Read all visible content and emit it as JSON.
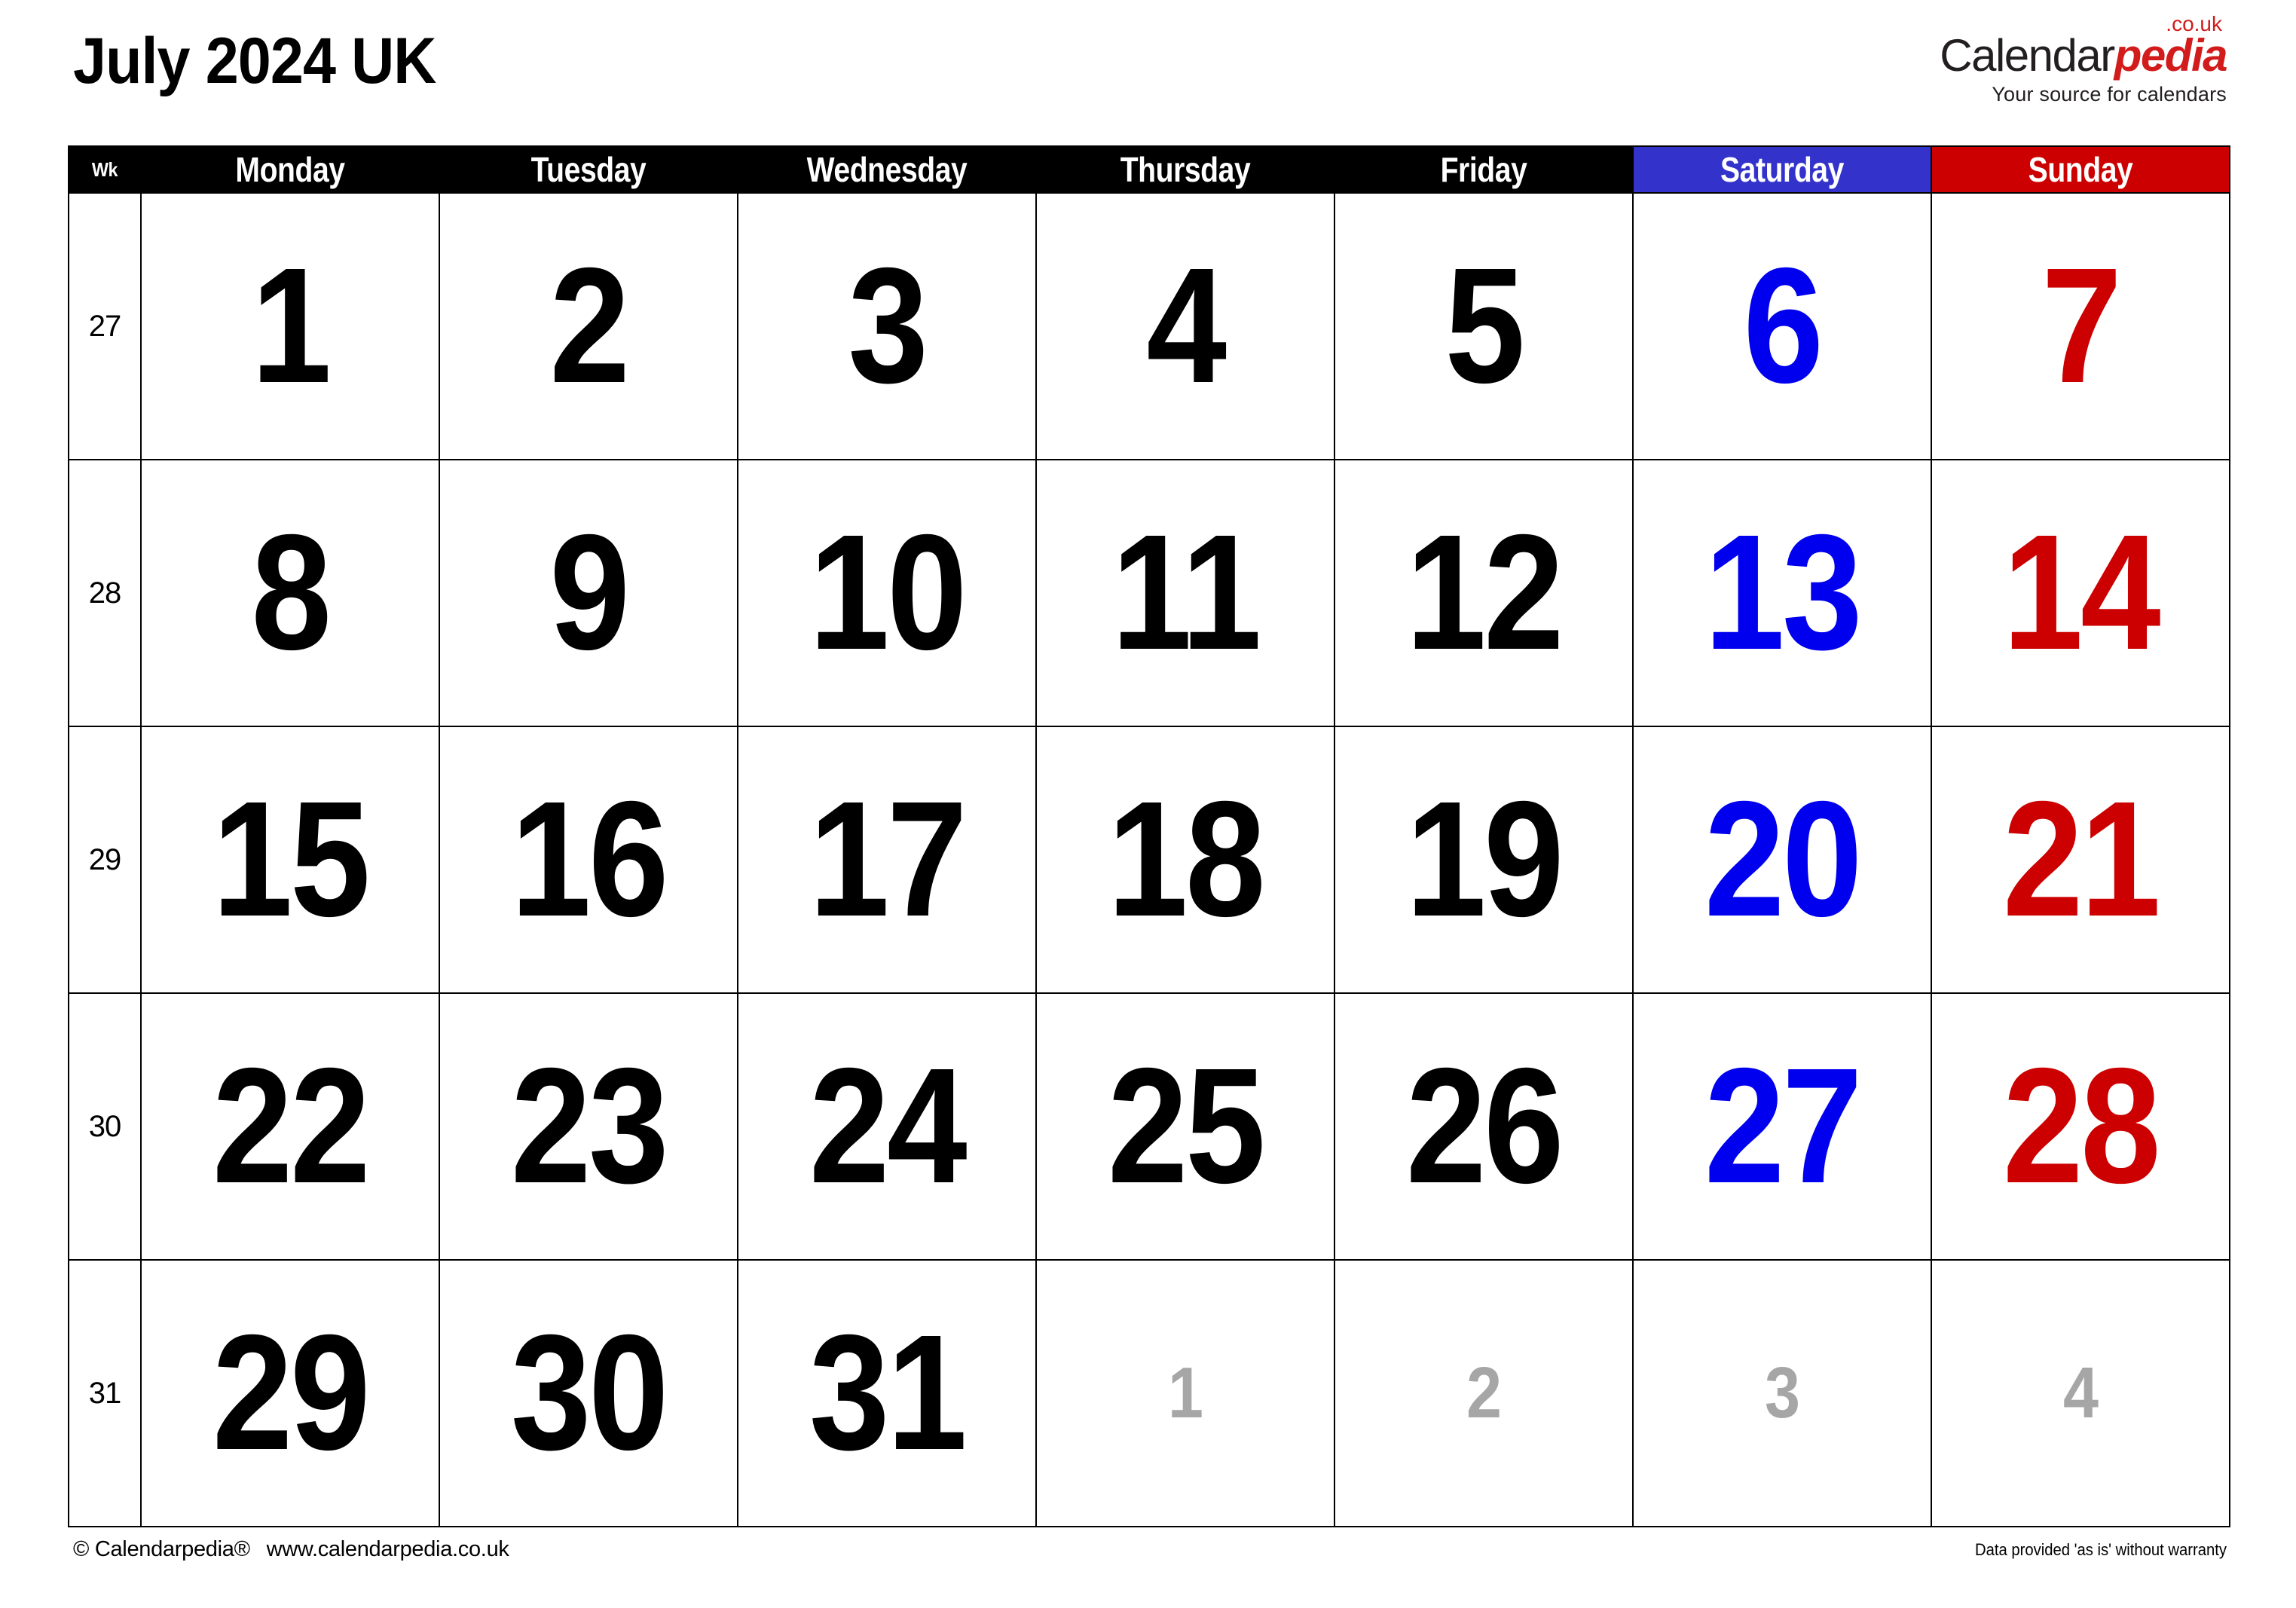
{
  "header": {
    "title": "July 2024 UK"
  },
  "logo": {
    "name_first": "Calendar",
    "name_second": "pedia",
    "tld": ".co.uk",
    "tagline": "Your source for calendars"
  },
  "calendar": {
    "week_column_header": "Wk",
    "day_headers": [
      "Monday",
      "Tuesday",
      "Wednesday",
      "Thursday",
      "Friday",
      "Saturday",
      "Sunday"
    ],
    "colors": {
      "header_background": "#000000",
      "header_text": "#ffffff",
      "saturday_background": "#3333cc",
      "sunday_background": "#cc0000",
      "saturday_text": "#0000ee",
      "sunday_text": "#cc0000",
      "weekday_text": "#000000",
      "other_month_text": "#a6a6a6",
      "grid_line": "#000000",
      "cell_background": "#ffffff"
    },
    "weeks": [
      {
        "week_number": "27",
        "days": [
          {
            "label": "1",
            "kind": "weekday"
          },
          {
            "label": "2",
            "kind": "weekday"
          },
          {
            "label": "3",
            "kind": "weekday"
          },
          {
            "label": "4",
            "kind": "weekday"
          },
          {
            "label": "5",
            "kind": "weekday"
          },
          {
            "label": "6",
            "kind": "saturday"
          },
          {
            "label": "7",
            "kind": "sunday"
          }
        ]
      },
      {
        "week_number": "28",
        "days": [
          {
            "label": "8",
            "kind": "weekday"
          },
          {
            "label": "9",
            "kind": "weekday"
          },
          {
            "label": "10",
            "kind": "weekday"
          },
          {
            "label": "11",
            "kind": "weekday"
          },
          {
            "label": "12",
            "kind": "weekday"
          },
          {
            "label": "13",
            "kind": "saturday"
          },
          {
            "label": "14",
            "kind": "sunday"
          }
        ]
      },
      {
        "week_number": "29",
        "days": [
          {
            "label": "15",
            "kind": "weekday"
          },
          {
            "label": "16",
            "kind": "weekday"
          },
          {
            "label": "17",
            "kind": "weekday"
          },
          {
            "label": "18",
            "kind": "weekday"
          },
          {
            "label": "19",
            "kind": "weekday"
          },
          {
            "label": "20",
            "kind": "saturday"
          },
          {
            "label": "21",
            "kind": "sunday"
          }
        ]
      },
      {
        "week_number": "30",
        "days": [
          {
            "label": "22",
            "kind": "weekday"
          },
          {
            "label": "23",
            "kind": "weekday"
          },
          {
            "label": "24",
            "kind": "weekday"
          },
          {
            "label": "25",
            "kind": "weekday"
          },
          {
            "label": "26",
            "kind": "weekday"
          },
          {
            "label": "27",
            "kind": "saturday"
          },
          {
            "label": "28",
            "kind": "sunday"
          }
        ]
      },
      {
        "week_number": "31",
        "days": [
          {
            "label": "29",
            "kind": "weekday"
          },
          {
            "label": "30",
            "kind": "weekday"
          },
          {
            "label": "31",
            "kind": "weekday"
          },
          {
            "label": "1",
            "kind": "other"
          },
          {
            "label": "2",
            "kind": "other"
          },
          {
            "label": "3",
            "kind": "other"
          },
          {
            "label": "4",
            "kind": "other"
          }
        ]
      }
    ]
  },
  "footer": {
    "copyright": "© Calendarpedia®",
    "website": "www.calendarpedia.co.uk",
    "disclaimer": "Data provided 'as is' without warranty"
  }
}
